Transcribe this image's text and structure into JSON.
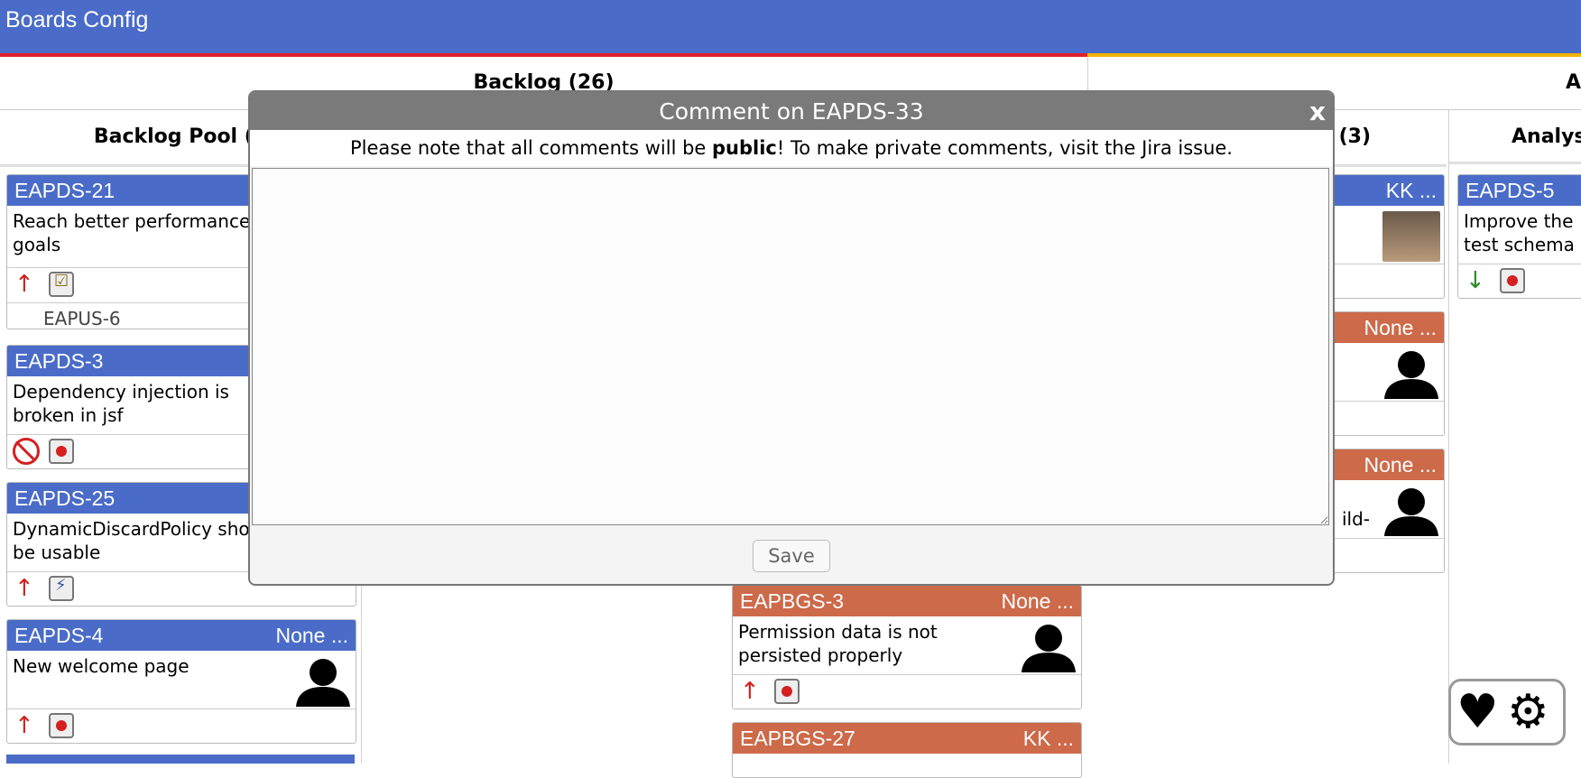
{
  "app": {
    "title": "Boards Config"
  },
  "states": [
    {
      "label": "Backlog (26)"
    },
    {
      "label": "A"
    }
  ],
  "columns": [
    {
      "label": "Backlog Pool (1"
    },
    {
      "label": ""
    },
    {
      "label": ""
    },
    {
      "label": "ing (3)"
    },
    {
      "label": "Analys"
    }
  ],
  "cards": [
    {
      "key": "EAPDS-21",
      "assignee": "",
      "summary": "Reach better performance goals",
      "priority": "up",
      "type": "check",
      "linked": "EAPUS-6"
    },
    {
      "key": "EAPDS-3",
      "assignee": "",
      "summary": "Dependency injection is broken in jsf",
      "priority": "blocked",
      "type": "bug"
    },
    {
      "key": "EAPDS-25",
      "assignee": "",
      "summary": "DynamicDiscardPolicy should be usable",
      "priority": "up",
      "type": "bolt"
    },
    {
      "key": "EAPDS-4",
      "assignee": "None ...",
      "summary": "New welcome page",
      "priority": "up",
      "type": "bug"
    },
    {
      "key": "EAPBGS-3",
      "assignee": "None ...",
      "summary": "Permission data is not persisted properly",
      "priority": "up",
      "type": "bug"
    },
    {
      "key": "EAPBGS-27",
      "assignee": "KK ...",
      "summary": ""
    },
    {
      "key": "",
      "assignee": "KK ...",
      "summary": ""
    },
    {
      "key": "",
      "assignee": "None ...",
      "summary": ""
    },
    {
      "key": "",
      "assignee": "None ...",
      "summary": "ild-"
    },
    {
      "key": "EAPDS-5",
      "assignee": "",
      "summary": "Improve the test schema",
      "priority": "down",
      "type": "bug"
    }
  ],
  "dialog": {
    "title": "Comment on EAPDS-33",
    "close_label": "x",
    "note_pre": "Please note that all comments will be ",
    "note_bold": "public",
    "note_post": "! To make private comments, visit the Jira issue.",
    "comment_value": "",
    "save_label": "Save"
  },
  "colors": {
    "header": "#4a6cc8",
    "card_blue": "#4a6cc8",
    "card_orange": "#cc6a4a",
    "stripe_red": "#e0202a",
    "stripe_yellow": "#f0b400"
  },
  "icons": {
    "heart": "heart-icon",
    "gear": "gear-icon"
  }
}
